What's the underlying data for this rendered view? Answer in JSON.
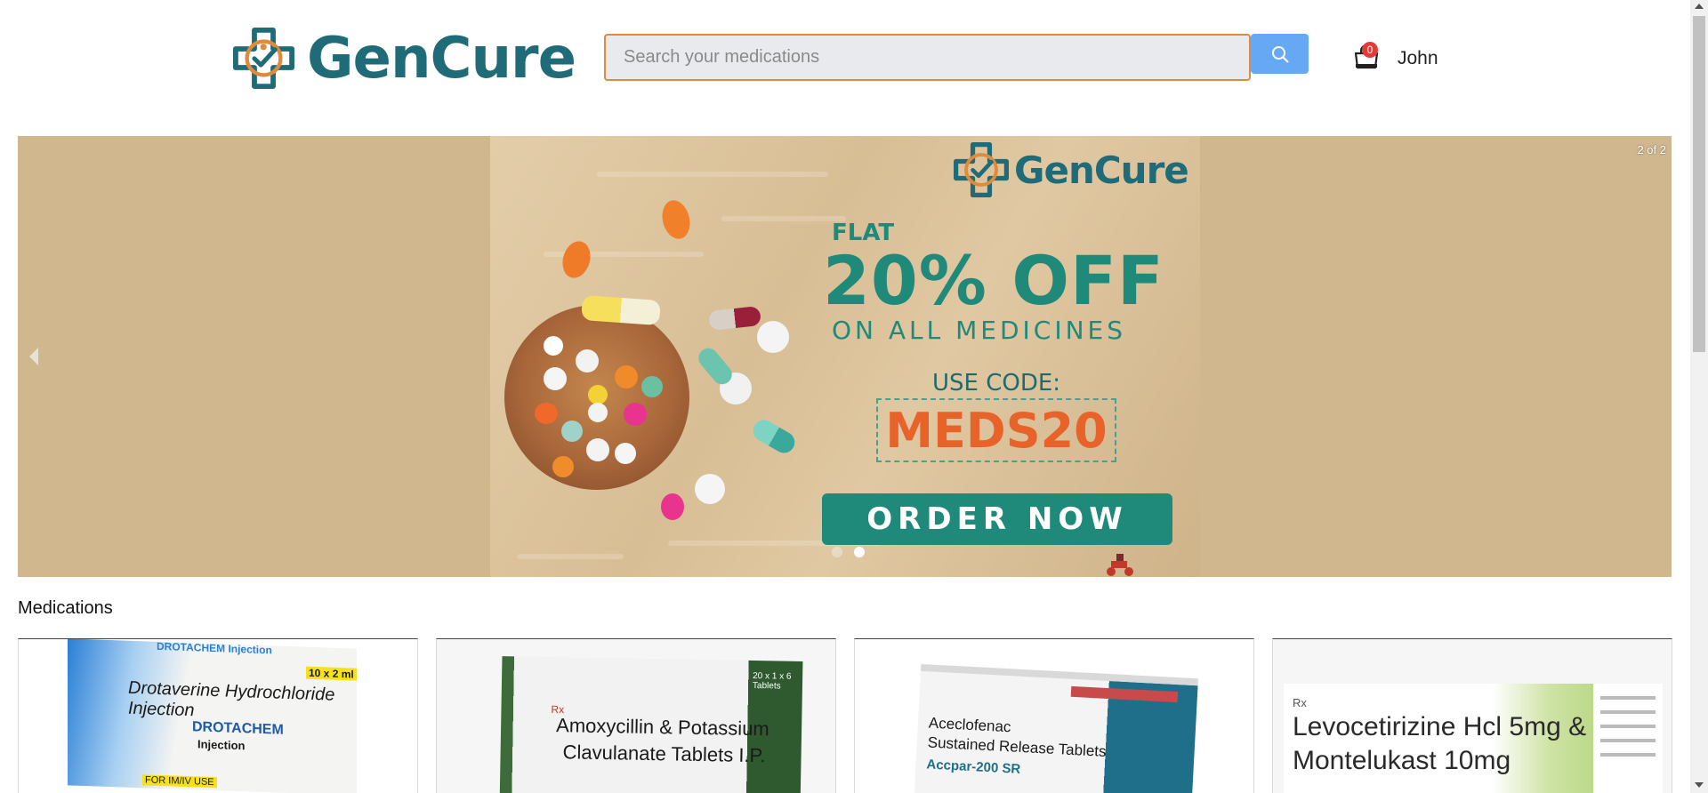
{
  "brand": {
    "name": "GenCure",
    "primary_color": "#1f6b77",
    "accent_color": "#e08a3c"
  },
  "header": {
    "search": {
      "placeholder": "Search your medications",
      "value": ""
    },
    "cart": {
      "count": "0",
      "icon": "cart-icon"
    },
    "user": {
      "name": "John"
    }
  },
  "carousel": {
    "counter": "2 of 2",
    "total_slides": 2,
    "active_slide": 2,
    "banner": {
      "brand": "GenCure",
      "flat": "FLAT",
      "discount": "20% OFF",
      "subtitle": "ON ALL MEDICINES",
      "use_code_label": "USE CODE:",
      "code": "MEDS20",
      "cta": "ORDER NOW"
    }
  },
  "medications": {
    "title": "Medications",
    "items": [
      {
        "box_lines": [
          "DROTACHEM Injection",
          "10 x 2 ml",
          "Drotaverine Hydrochloride Injection",
          "DROTACHEM",
          "Injection",
          "FOR IM/IV USE"
        ]
      },
      {
        "box_lines": [
          "20 x 1 x 6 Tablets",
          "Rx",
          "Amoxycillin & Potassium",
          "Clavulanate Tablets I.P."
        ]
      },
      {
        "box_lines": [
          "Aceclofenac",
          "Sustained Release Tablets",
          "Accpar-200 SR"
        ]
      },
      {
        "box_lines": [
          "Rx",
          "Levocetirizine Hcl 5mg &",
          "Montelukast 10mg"
        ]
      }
    ]
  }
}
